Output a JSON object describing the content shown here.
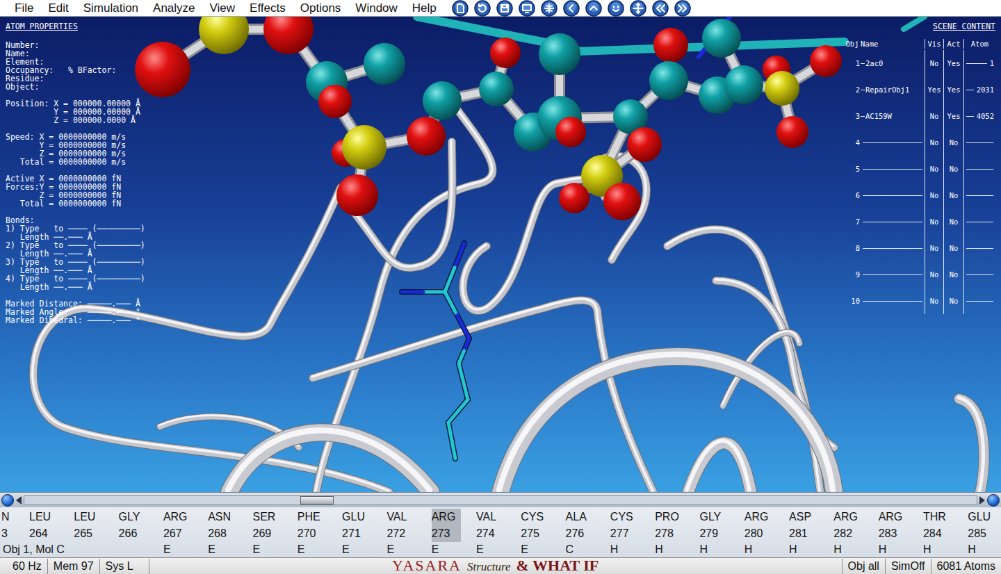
{
  "menu": [
    "File",
    "Edit",
    "Simulation",
    "Analyze",
    "View",
    "Effects",
    "Options",
    "Window",
    "Help"
  ],
  "atom_properties": {
    "title": "ATOM PROPERTIES",
    "groups": [
      [
        "Number:",
        "Name:",
        "Element:",
        "Occupancy:   % BFactor:",
        "Residue:",
        "Object:"
      ],
      [
        "Position: X = 000000.00000 Å",
        "          Y = 000000.00000 Å",
        "          Z = 000000.0000 Å"
      ],
      [
        "Speed: X = 0000000000 m/s",
        "       Y = 0000000000 m/s",
        "       Z = 0000000000 m/s",
        "   Total = 0000000000 m/s"
      ],
      [
        "Active X = 0000000000 fN",
        "Forces:Y = 0000000000 fN",
        "       Z = 0000000000 fN",
        "   Total = 0000000000 fN"
      ],
      [
        "Bonds:",
        "1) Type   to ──── (─────────)",
        "   Length ──.─── Å",
        "2) Type   to ──── (─────────)",
        "   Length ──.─── Å",
        "3) Type   to ──── (─────────)",
        "   Length ──.─── Å",
        "4) Type   to ──── (─────────)",
        "   Length ──.─── Å"
      ],
      [
        "Marked Distance: ─────.─── Å",
        "Marked Angle:    ─────.─── °",
        "Marked Dihedral: ─────.─── °"
      ]
    ]
  },
  "scene_content": {
    "title": "SCENE CONTENT",
    "columns": [
      "Obj",
      "Name",
      "Vis",
      "Act",
      "Atom"
    ],
    "rows": [
      {
        "obj": "1",
        "name": "2ac0",
        "vis": "No",
        "act": "Yes",
        "atom": "1"
      },
      {
        "obj": "2",
        "name": "RepairObj1",
        "vis": "Yes",
        "act": "Yes",
        "atom": "2031"
      },
      {
        "obj": "3",
        "name": "AC159W",
        "vis": "No",
        "act": "Yes",
        "atom": "4052"
      },
      {
        "obj": "4",
        "name": "",
        "vis": "No",
        "act": "No",
        "atom": ""
      },
      {
        "obj": "5",
        "name": "",
        "vis": "No",
        "act": "No",
        "atom": ""
      },
      {
        "obj": "6",
        "name": "",
        "vis": "No",
        "act": "No",
        "atom": ""
      },
      {
        "obj": "7",
        "name": "",
        "vis": "No",
        "act": "No",
        "atom": ""
      },
      {
        "obj": "8",
        "name": "",
        "vis": "No",
        "act": "No",
        "atom": ""
      },
      {
        "obj": "9",
        "name": "",
        "vis": "No",
        "act": "No",
        "atom": ""
      },
      {
        "obj": "10",
        "name": "",
        "vis": "No",
        "act": "No",
        "atom": ""
      }
    ]
  },
  "scrollbar": {
    "thumb_position": 0.3
  },
  "sequence": {
    "label": "Obj 1, Mol C",
    "residues": [
      {
        "name": "N",
        "number": "3",
        "ss": "",
        "selected": false,
        "clipped": true
      },
      {
        "name": "LEU",
        "number": "264",
        "ss": "",
        "selected": false,
        "clipped": false
      },
      {
        "name": "LEU",
        "number": "265",
        "ss": "",
        "selected": false,
        "clipped": false
      },
      {
        "name": "GLY",
        "number": "266",
        "ss": "",
        "selected": false,
        "clipped": false
      },
      {
        "name": "ARG",
        "number": "267",
        "ss": "E",
        "selected": false,
        "clipped": false
      },
      {
        "name": "ASN",
        "number": "268",
        "ss": "E",
        "selected": false,
        "clipped": false
      },
      {
        "name": "SER",
        "number": "269",
        "ss": "E",
        "selected": false,
        "clipped": false
      },
      {
        "name": "PHE",
        "number": "270",
        "ss": "E",
        "selected": false,
        "clipped": false
      },
      {
        "name": "GLU",
        "number": "271",
        "ss": "E",
        "selected": false,
        "clipped": false
      },
      {
        "name": "VAL",
        "number": "272",
        "ss": "E",
        "selected": false,
        "clipped": false
      },
      {
        "name": "ARG",
        "number": "273",
        "ss": "E",
        "selected": true,
        "clipped": false
      },
      {
        "name": "VAL",
        "number": "274",
        "ss": "E",
        "selected": false,
        "clipped": false
      },
      {
        "name": "CYS",
        "number": "275",
        "ss": "E",
        "selected": false,
        "clipped": false
      },
      {
        "name": "ALA",
        "number": "276",
        "ss": "C",
        "selected": false,
        "clipped": false
      },
      {
        "name": "CYS",
        "number": "277",
        "ss": "H",
        "selected": false,
        "clipped": false
      },
      {
        "name": "PRO",
        "number": "278",
        "ss": "H",
        "selected": false,
        "clipped": false
      },
      {
        "name": "GLY",
        "number": "279",
        "ss": "H",
        "selected": false,
        "clipped": false
      },
      {
        "name": "ARG",
        "number": "280",
        "ss": "H",
        "selected": false,
        "clipped": false
      },
      {
        "name": "ASP",
        "number": "281",
        "ss": "H",
        "selected": false,
        "clipped": false
      },
      {
        "name": "ARG",
        "number": "282",
        "ss": "H",
        "selected": false,
        "clipped": false
      },
      {
        "name": "ARG",
        "number": "283",
        "ss": "H",
        "selected": false,
        "clipped": false
      },
      {
        "name": "THR",
        "number": "284",
        "ss": "H",
        "selected": false,
        "clipped": false
      },
      {
        "name": "GLU",
        "number": "285",
        "ss": "H",
        "selected": false,
        "clipped": false
      }
    ]
  },
  "status_bar": {
    "left": [
      "60 Hz",
      "Mem 97",
      "Sys L"
    ],
    "logo": {
      "name": "YASARA",
      "product": "Structure",
      "suffix": "& WHAT IF"
    },
    "right": [
      "Obj all",
      "SimOff",
      "6081 Atoms"
    ]
  }
}
